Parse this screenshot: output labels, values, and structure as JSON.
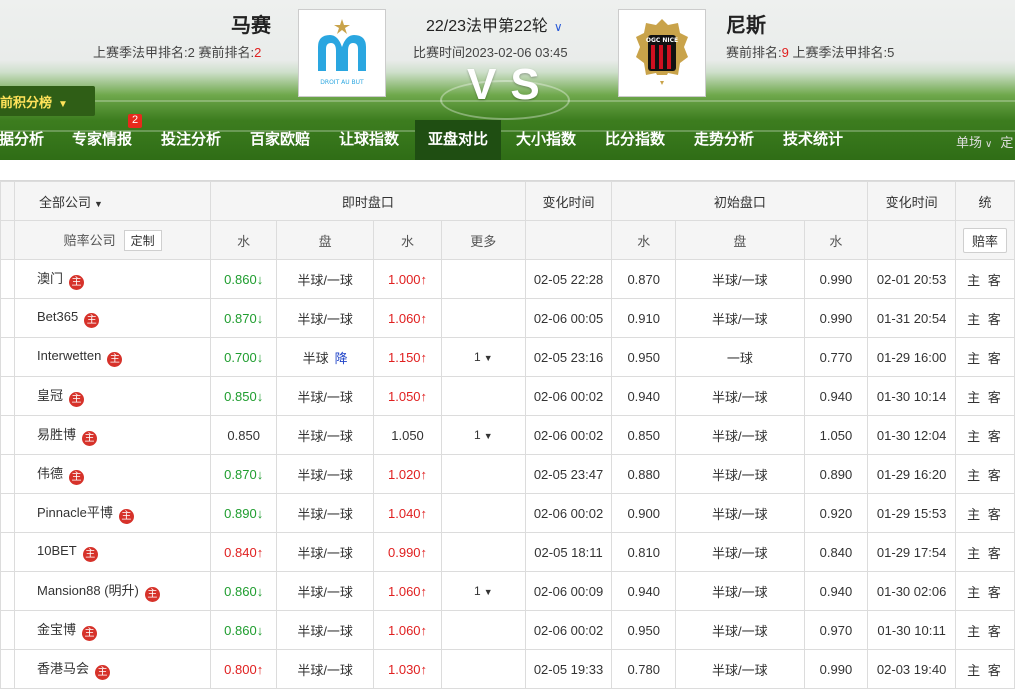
{
  "header": {
    "home": {
      "name": "马赛",
      "meta_prefix": "上赛季法甲排名:2  赛前排名:",
      "pre_rank": "2"
    },
    "away": {
      "name": "尼斯",
      "meta_prefix": "赛前排名:",
      "pre_rank": "9",
      "meta_suffix": "  上赛季法甲排名:5"
    },
    "match_title": "22/23法甲第22轮",
    "match_time": "比赛时间2023-02-06 03:45",
    "vs": "VS"
  },
  "ranking_pill": "前积分榜",
  "nav": {
    "items": [
      "据分析",
      "专家情报",
      "投注分析",
      "百家欧赔",
      "让球指数",
      "亚盘对比",
      "大小指数",
      "比分指数",
      "走势分析",
      "技术统计"
    ],
    "badge": "2",
    "right_label": "单场",
    "right_cut": "定"
  },
  "colors": {
    "up": "#e02020",
    "down": "#1f9d2f",
    "active_nav": "#1f4e12",
    "host_badge": "#d6322a"
  },
  "table": {
    "group_headers": {
      "all_companies": "全部公司",
      "live": "即时盘口",
      "change_time": "变化时间",
      "initial": "初始盘口",
      "change_time2": "变化时间",
      "stats_cut": "统"
    },
    "sub_headers": {
      "company": "赔率公司",
      "custom": "定制",
      "water": "水",
      "line": "盘",
      "water2": "水",
      "more": "更多",
      "w3": "水",
      "l2": "盘",
      "w4": "水",
      "odds_cut": "赔率"
    },
    "host_mark": "主",
    "rows": [
      {
        "company": "澳门",
        "lw1": "0.860",
        "lw1d": "down",
        "line": "半球/一球",
        "lw2": "1.000",
        "lw2d": "up",
        "more": "",
        "time": "02-05 22:28",
        "iw1": "0.870",
        "iline": "半球/一球",
        "iw2": "0.990",
        "itime": "02-01 20:53",
        "stats": "主 客"
      },
      {
        "company": "Bet365",
        "lw1": "0.870",
        "lw1d": "down",
        "line": "半球/一球",
        "lw2": "1.060",
        "lw2d": "up",
        "more": "",
        "time": "02-06 00:05",
        "iw1": "0.910",
        "iline": "半球/一球",
        "iw2": "0.990",
        "itime": "01-31 20:54",
        "stats": "主 客"
      },
      {
        "company": "Interwetten",
        "lw1": "0.700",
        "lw1d": "down",
        "line": "半球",
        "line_tag": "降",
        "lw2": "1.150",
        "lw2d": "up",
        "more": "1",
        "time": "02-05 23:16",
        "iw1": "0.950",
        "iline": "一球",
        "iw2": "0.770",
        "itime": "01-29 16:00",
        "stats": "主 客"
      },
      {
        "company": "皇冠",
        "lw1": "0.850",
        "lw1d": "down",
        "line": "半球/一球",
        "lw2": "1.050",
        "lw2d": "up",
        "more": "",
        "time": "02-06 00:02",
        "iw1": "0.940",
        "iline": "半球/一球",
        "iw2": "0.940",
        "itime": "01-30 10:14",
        "stats": "主 客"
      },
      {
        "company": "易胜博",
        "lw1": "0.850",
        "lw1d": "",
        "line": "半球/一球",
        "lw2": "1.050",
        "lw2d": "",
        "more": "1",
        "time": "02-06 00:02",
        "iw1": "0.850",
        "iline": "半球/一球",
        "iw2": "1.050",
        "itime": "01-30 12:04",
        "stats": "主 客"
      },
      {
        "company": "伟德",
        "lw1": "0.870",
        "lw1d": "down",
        "line": "半球/一球",
        "lw2": "1.020",
        "lw2d": "up",
        "more": "",
        "time": "02-05 23:47",
        "iw1": "0.880",
        "iline": "半球/一球",
        "iw2": "0.890",
        "itime": "01-29 16:20",
        "stats": "主 客"
      },
      {
        "company": "Pinnacle平博",
        "lw1": "0.890",
        "lw1d": "down",
        "line": "半球/一球",
        "lw2": "1.040",
        "lw2d": "up",
        "more": "",
        "time": "02-06 00:02",
        "iw1": "0.900",
        "iline": "半球/一球",
        "iw2": "0.920",
        "itime": "01-29 15:53",
        "stats": "主 客"
      },
      {
        "company": "10BET",
        "lw1": "0.840",
        "lw1d": "up",
        "line": "半球/一球",
        "lw2": "0.990",
        "lw2d": "up",
        "more": "",
        "time": "02-05 18:11",
        "iw1": "0.810",
        "iline": "半球/一球",
        "iw2": "0.840",
        "itime": "01-29 17:54",
        "stats": "主 客"
      },
      {
        "company": "Mansion88 (明升)",
        "lw1": "0.860",
        "lw1d": "down",
        "line": "半球/一球",
        "lw2": "1.060",
        "lw2d": "up",
        "more": "1",
        "time": "02-06 00:09",
        "iw1": "0.940",
        "iline": "半球/一球",
        "iw2": "0.940",
        "itime": "01-30 02:06",
        "stats": "主 客"
      },
      {
        "company": "金宝博",
        "lw1": "0.860",
        "lw1d": "down",
        "line": "半球/一球",
        "lw2": "1.060",
        "lw2d": "up",
        "more": "",
        "time": "02-06 00:02",
        "iw1": "0.950",
        "iline": "半球/一球",
        "iw2": "0.970",
        "itime": "01-30 10:11",
        "stats": "主 客"
      },
      {
        "company": "香港马会",
        "lw1": "0.800",
        "lw1d": "up",
        "line": "半球/一球",
        "lw2": "1.030",
        "lw2d": "up",
        "more": "",
        "time": "02-05 19:33",
        "iw1": "0.780",
        "iline": "半球/一球",
        "iw2": "0.990",
        "itime": "02-03 19:40",
        "stats": "主 客"
      }
    ]
  }
}
